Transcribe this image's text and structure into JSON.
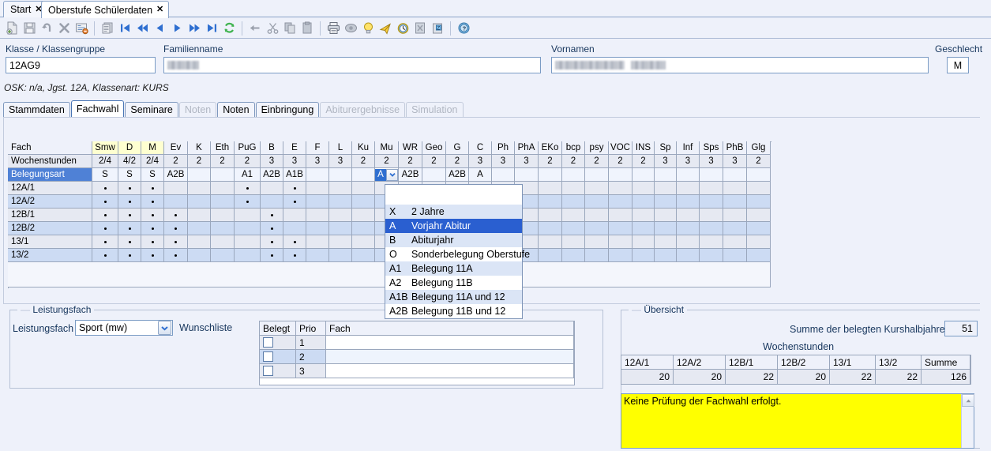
{
  "window_tabs": [
    {
      "label": "Start",
      "active": false
    },
    {
      "label": "Oberstufe Schülerdaten",
      "active": true
    }
  ],
  "toolbar": {
    "icons": [
      "new-document-icon",
      "save-icon",
      "undo-icon",
      "delete-icon",
      "edit-record-icon",
      "separator",
      "list-icon",
      "first-record-icon",
      "previous-page-icon",
      "previous-record-icon",
      "next-record-icon",
      "next-page-icon",
      "last-record-icon",
      "refresh-icon",
      "separator",
      "back-arrow-icon",
      "cut-icon",
      "copy-icon",
      "paste-icon",
      "separator",
      "print-icon",
      "preview-icon",
      "lightbulb-icon",
      "send-icon",
      "clock-icon",
      "excel-export-icon",
      "zip-export-icon",
      "separator",
      "help-icon"
    ]
  },
  "header": {
    "klasse_label": "Klasse / Klassengruppe",
    "klasse_value": "12AG9",
    "familienname_label": "Familienname",
    "familienname_value": "",
    "vornamen_label": "Vornamen",
    "vornamen_value": "",
    "geschlecht_label": "Geschlecht",
    "geschlecht_value": "M",
    "info_line": "OSK: n/a, Jgst. 12A, Klassenart: KURS"
  },
  "inner_tabs": [
    {
      "label": "Stammdaten",
      "active": false,
      "disabled": false
    },
    {
      "label": "Fachwahl",
      "active": true,
      "disabled": false
    },
    {
      "label": "Seminare",
      "active": false,
      "disabled": false
    },
    {
      "label": "Noten",
      "active": false,
      "disabled": true
    },
    {
      "label": "Noten",
      "active": false,
      "disabled": false
    },
    {
      "label": "Einbringung",
      "active": false,
      "disabled": false
    },
    {
      "label": "Abiturergebnisse",
      "active": false,
      "disabled": true
    },
    {
      "label": "Simulation",
      "active": false,
      "disabled": true
    }
  ],
  "grid": {
    "row_header_label": "Fach",
    "subjects": [
      "Smw",
      "D",
      "M",
      "Ev",
      "K",
      "Eth",
      "PuG",
      "B",
      "E",
      "F",
      "L",
      "Ku",
      "Mu",
      "WR",
      "Geo",
      "G",
      "C",
      "Ph",
      "PhA",
      "EKo",
      "bcp",
      "psy",
      "VOC",
      "INS",
      "Sp",
      "Inf",
      "Sps",
      "PhB",
      "Glg"
    ],
    "highlighted_subjects": [
      "Smw",
      "D",
      "M"
    ],
    "wochenstunden_label": "Wochenstunden",
    "wochenstunden": [
      "2/4",
      "4/2",
      "2/4",
      "2",
      "2",
      "2",
      "2",
      "3",
      "3",
      "3",
      "3",
      "2",
      "2",
      "2",
      "2",
      "2",
      "3",
      "3",
      "3",
      "2",
      "2",
      "2",
      "2",
      "2",
      "3",
      "3",
      "3",
      "3",
      "2"
    ],
    "belegungsart_label": "Belegungsart",
    "belegungsart": [
      "S",
      "S",
      "S",
      "A2B",
      "",
      "",
      "A1",
      "A2B",
      "A1B",
      "",
      "",
      "",
      "A",
      "A2B",
      "",
      "A2B",
      "A",
      "",
      "",
      "",
      "",
      "",
      "",
      "",
      "",
      "",
      "",
      "",
      ""
    ],
    "belegungsart_combo_index": 12,
    "belegungsart_combo_value": "A",
    "terms": [
      {
        "label": "12A/1",
        "marks": [
          1,
          1,
          1,
          0,
          0,
          0,
          1,
          0,
          1,
          0,
          0,
          0,
          0,
          0,
          0,
          0,
          0,
          0,
          0,
          0,
          0,
          0,
          0,
          0,
          0,
          0,
          0,
          0,
          0
        ]
      },
      {
        "label": "12A/2",
        "marks": [
          1,
          1,
          1,
          0,
          0,
          0,
          1,
          0,
          1,
          0,
          0,
          0,
          0,
          0,
          0,
          0,
          0,
          0,
          0,
          0,
          0,
          0,
          0,
          0,
          0,
          0,
          0,
          0,
          0
        ]
      },
      {
        "label": "12B/1",
        "marks": [
          1,
          1,
          1,
          1,
          0,
          0,
          0,
          1,
          0,
          0,
          0,
          0,
          0,
          0,
          0,
          0,
          0,
          0,
          0,
          0,
          0,
          0,
          0,
          0,
          0,
          0,
          0,
          0,
          0
        ]
      },
      {
        "label": "12B/2",
        "marks": [
          1,
          1,
          1,
          1,
          0,
          0,
          0,
          1,
          0,
          0,
          0,
          0,
          0,
          0,
          0,
          0,
          0,
          0,
          0,
          0,
          0,
          0,
          0,
          0,
          0,
          0,
          0,
          0,
          0
        ]
      },
      {
        "label": "13/1",
        "marks": [
          1,
          1,
          1,
          1,
          0,
          0,
          0,
          1,
          1,
          0,
          0,
          0,
          0,
          0,
          0,
          0,
          0,
          0,
          0,
          0,
          0,
          0,
          0,
          0,
          0,
          0,
          0,
          0,
          0
        ]
      },
      {
        "label": "13/2",
        "marks": [
          1,
          1,
          1,
          1,
          0,
          0,
          0,
          1,
          1,
          0,
          0,
          0,
          0,
          0,
          0,
          0,
          0,
          0,
          0,
          0,
          0,
          0,
          0,
          0,
          0,
          0,
          0,
          0,
          0
        ]
      }
    ]
  },
  "dropdown": {
    "options": [
      {
        "code": "X",
        "label": "2 Jahre",
        "selected": false
      },
      {
        "code": "A",
        "label": "Vorjahr Abitur",
        "selected": true
      },
      {
        "code": "B",
        "label": "Abiturjahr",
        "selected": false
      },
      {
        "code": "O",
        "label": "Sonderbelegung Oberstufe",
        "selected": false
      },
      {
        "code": "A1",
        "label": "Belegung 11A",
        "selected": false
      },
      {
        "code": "A2",
        "label": "Belegung 11B",
        "selected": false
      },
      {
        "code": "A1B",
        "label": "Belegung 11A und 12",
        "selected": false
      },
      {
        "code": "A2B",
        "label": "Belegung 11B und 12",
        "selected": false
      }
    ]
  },
  "leistungsfach": {
    "group_title": "Leistungsfach",
    "field_label": "Leistungsfach",
    "value": "Sport (mw)",
    "wunschliste_label": "Wunschliste",
    "wunschliste": {
      "columns": [
        "Belegt",
        "Prio",
        "Fach"
      ],
      "rows": [
        {
          "belegt": false,
          "prio": "1",
          "fach": ""
        },
        {
          "belegt": false,
          "prio": "2",
          "fach": ""
        },
        {
          "belegt": false,
          "prio": "3",
          "fach": ""
        }
      ]
    }
  },
  "uebersicht": {
    "group_title": "Übersicht",
    "summe_label": "Summe der belegten Kurshalbjahre",
    "summe_value": "51",
    "wochenstunden_label": "Wochenstunden",
    "columns": [
      "12A/1",
      "12A/2",
      "12B/1",
      "12B/2",
      "13/1",
      "13/2",
      "Summe"
    ],
    "values": [
      "20",
      "20",
      "22",
      "20",
      "22",
      "22",
      "126"
    ],
    "notice": "Keine Prüfung der Fachwahl erfolgt."
  },
  "colors": {
    "accent": "#4f81d6",
    "selection": "#2a5fd0",
    "highlight_header": "#feffd0",
    "notice_bg": "#ffff00",
    "panel_bg": "#eef1fa"
  }
}
